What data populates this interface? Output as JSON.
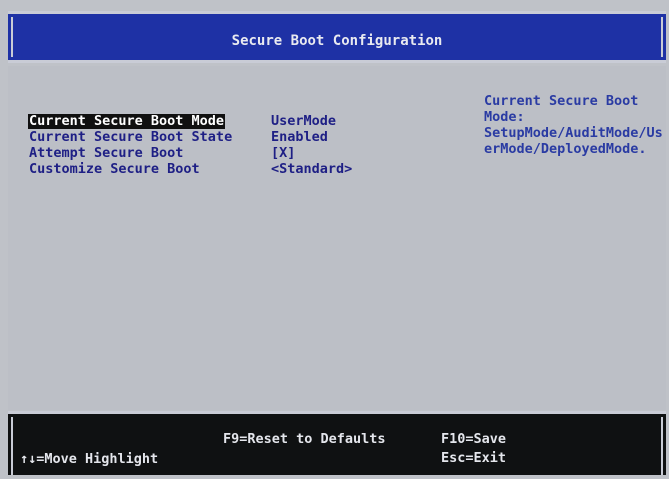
{
  "title": "Secure Boot Configuration",
  "menu": {
    "items": [
      {
        "label": "Current Secure Boot Mode",
        "value": "UserMode",
        "highlighted": true
      },
      {
        "label": "Current Secure Boot State",
        "value": "Enabled",
        "highlighted": false
      },
      {
        "label": "Attempt Secure Boot",
        "value": "[X]",
        "highlighted": false
      },
      {
        "label": "Customize Secure Boot",
        "value": "<Standard>",
        "highlighted": false
      }
    ]
  },
  "help": {
    "text": "Current Secure Boot\nMode:\nSetupMode/AuditMode/Us\nerMode/DeployedMode."
  },
  "footer": {
    "move_highlight": "↑↓=Move Highlight",
    "reset_defaults": "F9=Reset to Defaults",
    "save": "F10=Save",
    "exit": "Esc=Exit"
  },
  "colors": {
    "title_bar_bg": "#1e31a5",
    "panel_bg": "#bcbfc6",
    "item_text": "#1e1f85",
    "help_text": "#2a3ba3",
    "footer_bg": "#0f1112",
    "highlight_bg": "#101010"
  }
}
